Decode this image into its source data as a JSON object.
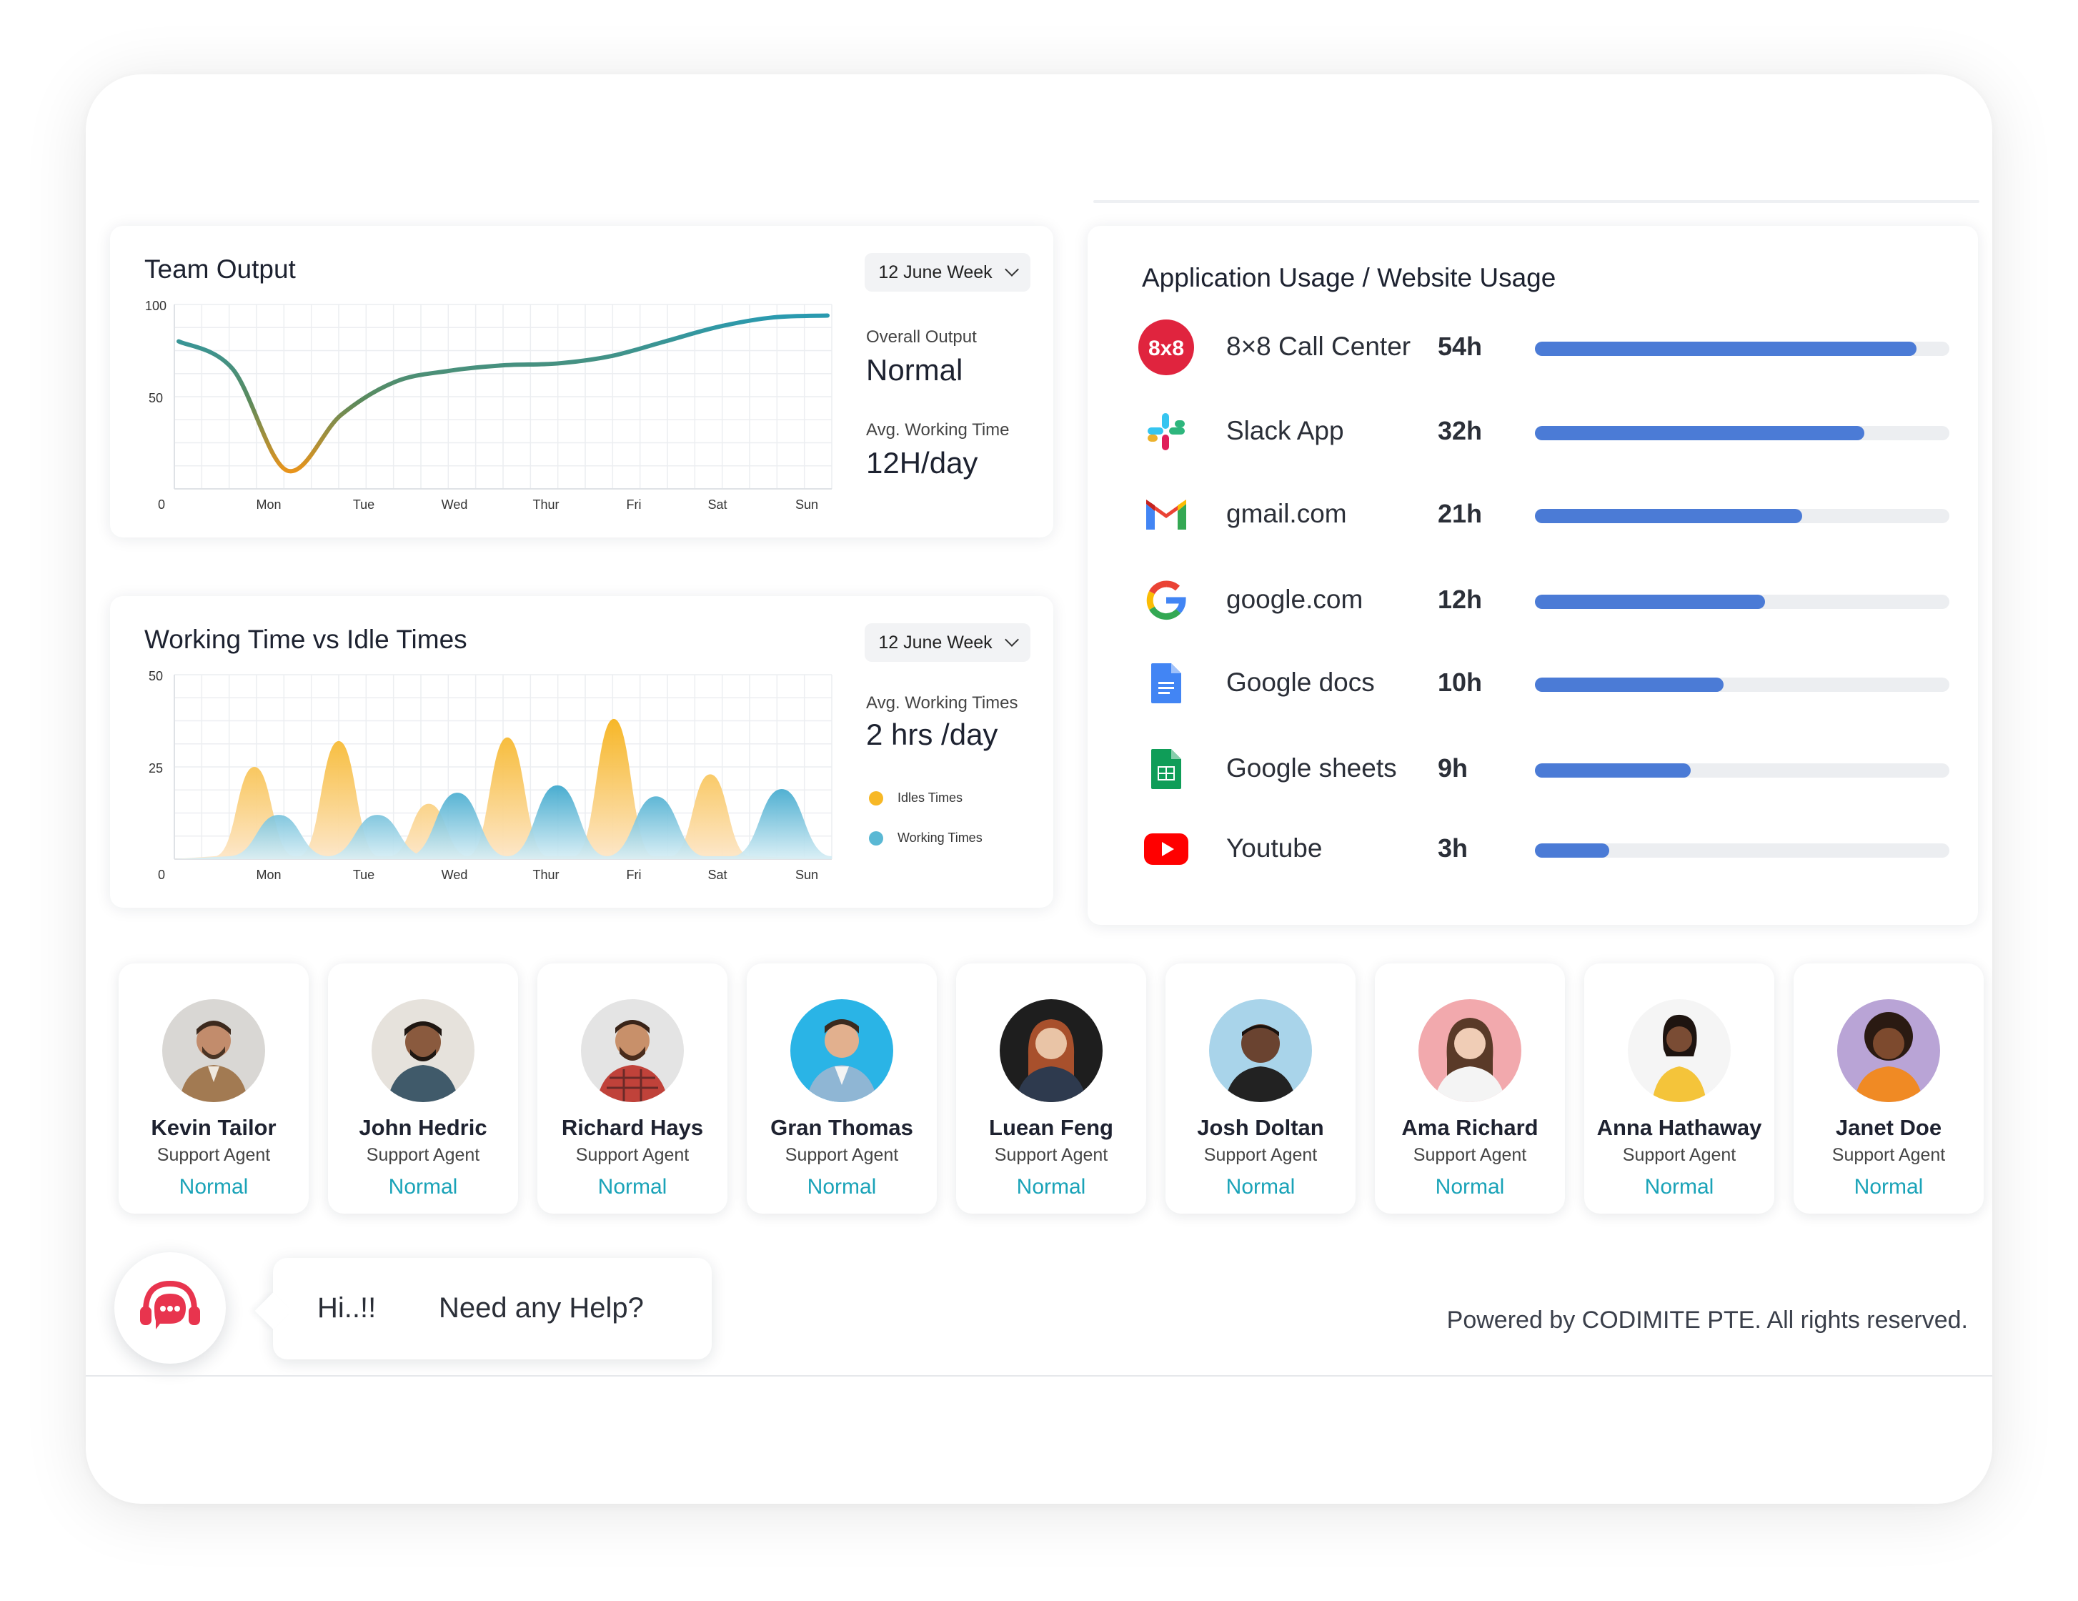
{
  "team_output": {
    "title": "Team Output",
    "week_label": "12 June Week",
    "overall_label": "Overall Output",
    "overall_value": "Normal",
    "avg_label": "Avg. Working Time",
    "avg_value": "12H/day"
  },
  "working_idle": {
    "title": "Working Time vs Idle Times",
    "week_label": "12 June Week",
    "avg_label": "Avg. Working Times",
    "avg_value": "2 hrs /day",
    "legend_idle": "Idles Times",
    "legend_working": "Working Times"
  },
  "colors": {
    "idle": "#f7b826",
    "working": "#5ab8d4",
    "bar_fill": "#4b7bd6",
    "status": "#1aa3b8",
    "help": "#e8344e"
  },
  "chart_data": [
    {
      "type": "line",
      "x": [
        "",
        "Mon",
        "",
        "Tue",
        "Wed",
        "Thur",
        "Fri",
        "Sat",
        "Sun"
      ],
      "x_ticks": [
        "Mon",
        "Tue",
        "Wed",
        "Thur",
        "Fri",
        "Sat",
        "Sun"
      ],
      "series": [
        {
          "values": [
            80,
            65,
            10,
            40,
            58,
            64,
            67,
            68,
            72,
            80,
            88,
            93,
            94
          ]
        }
      ],
      "ylim": [
        0,
        100
      ],
      "y_ticks": [
        "0",
        "50",
        "100"
      ],
      "grid": true
    },
    {
      "type": "area",
      "x_ticks": [
        "Mon",
        "Tue",
        "Wed",
        "Thur",
        "Fri",
        "Sat",
        "Sun"
      ],
      "series": [
        {
          "name": "Idles Times",
          "peaks": [
            25,
            32,
            15,
            33,
            38,
            23
          ]
        },
        {
          "name": "Working Times",
          "peaks": [
            12,
            12,
            18,
            20,
            17,
            19
          ]
        }
      ],
      "ylim": [
        0,
        50
      ],
      "y_ticks": [
        "0",
        "25",
        "50"
      ],
      "grid": true
    }
  ],
  "app_usage": {
    "title": "Application Usage / Website Usage",
    "items": [
      {
        "name": "8×8 Call Center",
        "hours": "54h",
        "icon": "eight-by-eight-icon",
        "fraction": 0.92
      },
      {
        "name": "Slack App",
        "hours": "32h",
        "icon": "slack-icon",
        "fraction": 0.795
      },
      {
        "name": "gmail.com",
        "hours": "21h",
        "icon": "gmail-icon",
        "fraction": 0.645
      },
      {
        "name": "google.com",
        "hours": "12h",
        "icon": "google-icon",
        "fraction": 0.555
      },
      {
        "name": "Google docs",
        "hours": "10h",
        "icon": "google-docs-icon",
        "fraction": 0.455
      },
      {
        "name": "Google sheets",
        "hours": "9h",
        "icon": "google-sheets-icon",
        "fraction": 0.375
      },
      {
        "name": "Youtube",
        "hours": "3h",
        "icon": "youtube-icon",
        "fraction": 0.18
      }
    ],
    "icon_text_8x8": "8x8"
  },
  "agents": [
    {
      "name": "Kevin Tailor",
      "role": "Support Agent",
      "status": "Normal"
    },
    {
      "name": "John Hedric",
      "role": "Support Agent",
      "status": "Normal"
    },
    {
      "name": "Richard Hays",
      "role": "Support Agent",
      "status": "Normal"
    },
    {
      "name": "Gran Thomas",
      "role": "Support Agent",
      "status": "Normal"
    },
    {
      "name": "Luean Feng",
      "role": "Support Agent",
      "status": "Normal"
    },
    {
      "name": "Josh Doltan",
      "role": "Support Agent",
      "status": "Normal"
    },
    {
      "name": "Ama Richard",
      "role": "Support Agent",
      "status": "Normal"
    },
    {
      "name": "Anna Hathaway",
      "role": "Support Agent",
      "status": "Normal"
    },
    {
      "name": "Janet Doe",
      "role": "Support Agent",
      "status": "Normal"
    }
  ],
  "help": {
    "greeting": "Hi..!!",
    "question": "Need any Help?"
  },
  "footer": {
    "text": "Powered by CODIMITE PTE. All rights reserved."
  }
}
